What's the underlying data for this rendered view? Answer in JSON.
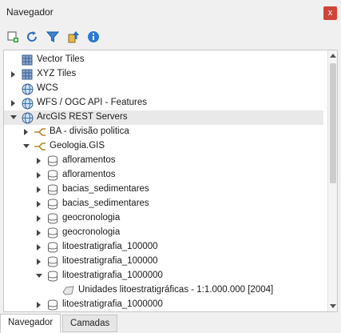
{
  "panel": {
    "title": "Navegador",
    "close_glyph": "x"
  },
  "toolbar": [
    {
      "name": "add-selected-layers-button",
      "icon": "add-layer-icon"
    },
    {
      "name": "refresh-button",
      "icon": "refresh-icon"
    },
    {
      "name": "filter-button",
      "icon": "filter-icon"
    },
    {
      "name": "collapse-all-button",
      "icon": "collapse-icon"
    },
    {
      "name": "properties-button",
      "icon": "info-icon"
    }
  ],
  "tree": {
    "items": [
      {
        "label": "Vector Tiles",
        "level": 0,
        "expand": "none",
        "icon": "grid-icon"
      },
      {
        "label": "XYZ Tiles",
        "level": 0,
        "expand": "collapsed",
        "icon": "grid-icon"
      },
      {
        "label": "WCS",
        "level": 0,
        "expand": "none",
        "icon": "globe-icon"
      },
      {
        "label": "WFS / OGC API - Features",
        "level": 0,
        "expand": "collapsed",
        "icon": "globe-icon"
      },
      {
        "label": "ArcGIS REST Servers",
        "level": 0,
        "expand": "expanded",
        "icon": "globe-icon",
        "selected": true
      },
      {
        "label": "BA - divisão politica",
        "level": 1,
        "expand": "collapsed",
        "icon": "connection-icon"
      },
      {
        "label": "Geologia.GIS",
        "level": 1,
        "expand": "expanded",
        "icon": "connection-icon"
      },
      {
        "label": "afloramentos",
        "level": 2,
        "expand": "collapsed",
        "icon": "database-icon"
      },
      {
        "label": "afloramentos",
        "level": 2,
        "expand": "collapsed",
        "icon": "database-icon"
      },
      {
        "label": "bacias_sedimentares",
        "level": 2,
        "expand": "collapsed",
        "icon": "database-icon"
      },
      {
        "label": "bacias_sedimentares",
        "level": 2,
        "expand": "collapsed",
        "icon": "database-icon"
      },
      {
        "label": "geocronologia",
        "level": 2,
        "expand": "collapsed",
        "icon": "database-icon"
      },
      {
        "label": "geocronologia",
        "level": 2,
        "expand": "collapsed",
        "icon": "database-icon"
      },
      {
        "label": "litoestratigrafia_100000",
        "level": 2,
        "expand": "collapsed",
        "icon": "database-icon"
      },
      {
        "label": "litoestratigrafia_100000",
        "level": 2,
        "expand": "collapsed",
        "icon": "database-icon"
      },
      {
        "label": "litoestratigrafia_1000000",
        "level": 2,
        "expand": "expanded",
        "icon": "database-icon"
      },
      {
        "label": "Unidades litoestratigráficas - 1:1.000.000 [2004]",
        "level": 3,
        "expand": "none",
        "icon": "polygon-layer-icon"
      },
      {
        "label": "litoestratigrafia_1000000",
        "level": 2,
        "expand": "collapsed",
        "icon": "database-icon"
      }
    ]
  },
  "tabs": [
    {
      "label": "Navegador",
      "active": true
    },
    {
      "label": "Camadas",
      "active": false
    }
  ],
  "colors": {
    "accent": "#1f6fb5",
    "close": "#d0443a",
    "selection": "#e9e9e9"
  }
}
